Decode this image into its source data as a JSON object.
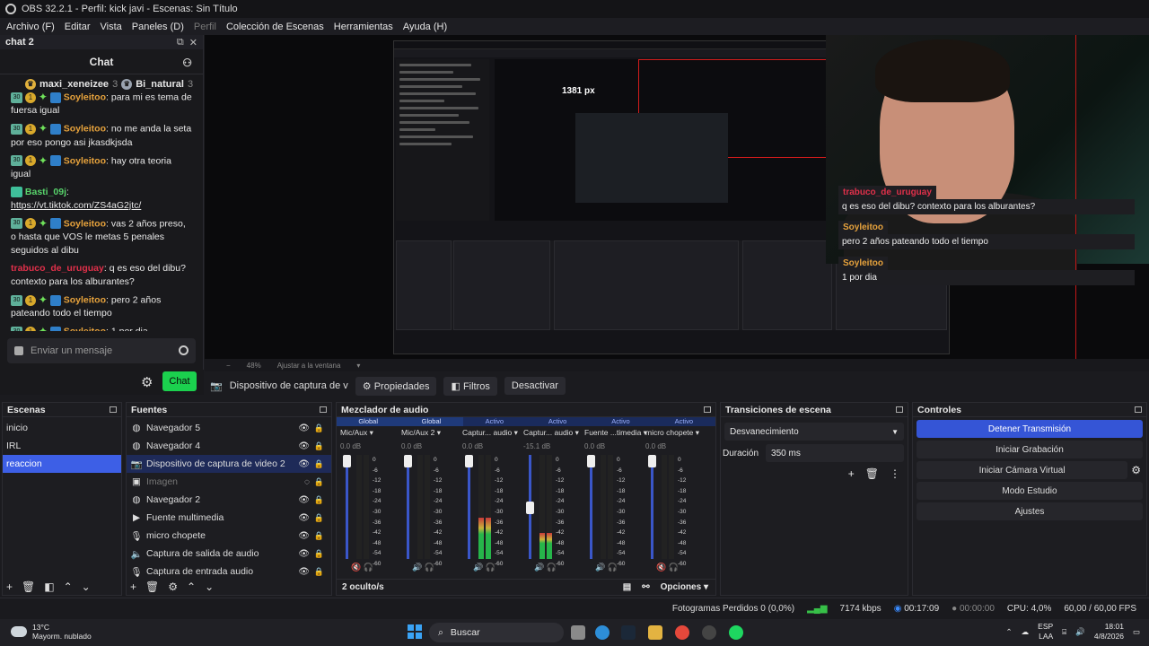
{
  "title": "OBS 32.2.1 - Perfil: kick javi - Escenas: Sin Título",
  "menu": [
    "Archivo (F)",
    "Editar",
    "Vista",
    "Paneles (D)",
    "Perfil",
    "Colección de Escenas",
    "Herramientas",
    "Ayuda (H)"
  ],
  "chat": {
    "dock_title": "chat 2",
    "header": "Chat",
    "top_users": [
      "maxi_xeneizee",
      "3",
      "Bi_natural",
      "3"
    ],
    "messages": [
      {
        "user": "Soyleitoo",
        "text": "para mi es tema de fuersa igual",
        "style": "gold"
      },
      {
        "user": "Soyleitoo",
        "text": "no me anda la seta por eso pongo asi jkasdkjsda",
        "style": "gold"
      },
      {
        "user": "Soyleitoo",
        "text": "hay otra teoria igual",
        "style": "gold"
      },
      {
        "user": "Basti_09j",
        "text": "https://vt.tiktok.com/ZS4aG2jtc/",
        "style": "green"
      },
      {
        "user": "Soyleitoo",
        "text": "vas 2 años preso, o hasta que VOS le metas 5 penales seguidos al dibu",
        "style": "gold"
      },
      {
        "user": "trabuco_de_uruguay",
        "text": "q es eso del dibu? contexto para los alburantes?",
        "style": "red"
      },
      {
        "user": "Soyleitoo",
        "text": "pero 2 años pateando todo el tiempo",
        "style": "gold"
      },
      {
        "user": "Soyleitoo",
        "text": "1 por dia",
        "style": "gold"
      }
    ],
    "badge_num": "30",
    "badge_level": "1",
    "input_placeholder": "Enviar un mensaje",
    "send_label": "Chat"
  },
  "preview": {
    "px_label": "1381 px",
    "overlay": [
      {
        "user": "trabuco_de_uruguay",
        "text": "q es eso del dibu? contexto para los alburantes?"
      },
      {
        "user": "Soyleitoo",
        "text": "pero 2 años pateando todo el tiempo"
      },
      {
        "user": "Soyleitoo",
        "text": "1 por dia"
      }
    ],
    "zoom": "48%",
    "fit": "Ajustar a la ventana"
  },
  "source_toolbar": {
    "selected": "Dispositivo de captura de v",
    "properties": "Propiedades",
    "filters": "Filtros",
    "deactivate": "Desactivar"
  },
  "scenes": {
    "title": "Escenas",
    "items": [
      "inicio",
      "IRL",
      "reaccion"
    ],
    "active": 2
  },
  "sources": {
    "title": "Fuentes",
    "items": [
      {
        "label": "Navegador 5",
        "icon": "browser-icon",
        "state": "normal"
      },
      {
        "label": "Navegador 4",
        "icon": "browser-icon",
        "state": "normal"
      },
      {
        "label": "Dispositivo de captura de video 2",
        "icon": "camera-icon",
        "state": "active"
      },
      {
        "label": "Imagen",
        "icon": "image-icon",
        "state": "disabled"
      },
      {
        "label": "Navegador 2",
        "icon": "browser-icon",
        "state": "normal"
      },
      {
        "label": "Fuente multimedia",
        "icon": "play-icon",
        "state": "normal"
      },
      {
        "label": "micro chopete",
        "icon": "mic-icon",
        "state": "normal"
      },
      {
        "label": "Captura de salida de audio",
        "icon": "speaker-icon",
        "state": "normal"
      },
      {
        "label": "Captura de entrada audio",
        "icon": "mic-icon",
        "state": "normal"
      }
    ]
  },
  "mixer": {
    "title": "Mezclador de audio",
    "tabs": [
      "Global",
      "Global",
      "Activo",
      "Activo",
      "Activo",
      "Activo"
    ],
    "channels": [
      {
        "name": "Mic/Aux",
        "db": "0.0 dB",
        "muted": true,
        "level": 0.0,
        "knob": 0.0
      },
      {
        "name": "Mic/Aux 2",
        "db": "0.0 dB",
        "muted": false,
        "level": 0.0,
        "knob": 0.0
      },
      {
        "name": "Captur... audio",
        "db": "0.0 dB",
        "muted": false,
        "level": 0.4,
        "knob": 0.0
      },
      {
        "name": "Captur... audio",
        "db": "-15.1 dB",
        "muted": false,
        "level": 0.25,
        "knob": 0.45
      },
      {
        "name": "Fuente ...timedia",
        "db": "0.0 dB",
        "muted": false,
        "level": 0.0,
        "knob": 0.0
      },
      {
        "name": "micro chopete",
        "db": "0.0 dB",
        "muted": true,
        "level": 0.0,
        "knob": 0.0
      }
    ],
    "scale": [
      "0",
      "-6",
      "-12",
      "-18",
      "-24",
      "-30",
      "-36",
      "-42",
      "-48",
      "-54",
      "-60"
    ],
    "hidden": "2 oculto/s",
    "options": "Opciones"
  },
  "transitions": {
    "title": "Transiciones de escena",
    "selected": "Desvanecimiento",
    "duration_label": "Duración",
    "duration_value": "350 ms"
  },
  "controls": {
    "title": "Controles",
    "buttons": [
      "Detener Transmisión",
      "Iniciar Grabación",
      "Iniciar Cámara Virtual",
      "Modo Estudio",
      "Ajustes"
    ]
  },
  "status": {
    "dropped": "Fotogramas Perdidos 0 (0,0%)",
    "kbps": "7174 kbps",
    "time_live": "00:17:09",
    "time_rec": "00:00:00",
    "cpu": "CPU: 4,0%",
    "fps": "60,00 / 60,00 FPS"
  },
  "taskbar": {
    "temp": "13°C",
    "weather": "Mayorm. nublado",
    "search": "Buscar",
    "lang": "ESP",
    "lang2": "LAA",
    "time": "18:01",
    "date": "4/8/2026"
  }
}
